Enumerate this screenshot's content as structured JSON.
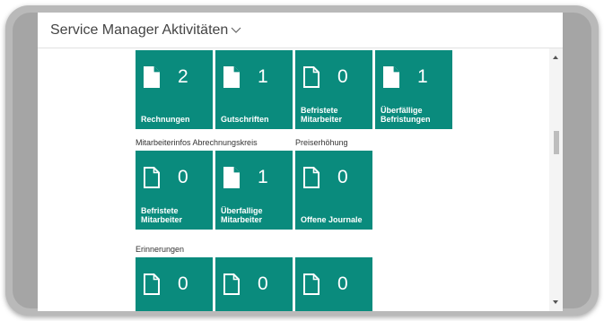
{
  "header": {
    "title": "Service Manager Aktivitäten"
  },
  "sections": {
    "abrechnung": "Mitarbeiterinfos Abrechnungskreis",
    "preis": "Preiserhöhung",
    "erinnerungen": "Erinnerungen"
  },
  "tiles": [
    {
      "count": "2",
      "label": "Rechnungen",
      "icon": "document-filled-icon"
    },
    {
      "count": "1",
      "label": "Gutschriften",
      "icon": "document-filled-icon"
    },
    {
      "count": "0",
      "label": "Befristete Mitarbeiter",
      "icon": "document-outline-icon"
    },
    {
      "count": "1",
      "label": "Überfällige Befristungen",
      "icon": "document-filled-icon"
    },
    {
      "count": "0",
      "label": "Befristete Mitarbeiter",
      "icon": "document-outline-icon"
    },
    {
      "count": "1",
      "label": "Überfallige Mitarbeiter",
      "icon": "document-filled-icon"
    },
    {
      "count": "0",
      "label": "Offene Journale",
      "icon": "document-outline-icon"
    },
    {
      "count": "0",
      "label": "",
      "icon": "document-outline-icon"
    },
    {
      "count": "0",
      "label": "",
      "icon": "document-outline-icon"
    },
    {
      "count": "0",
      "label": "",
      "icon": "document-outline-icon"
    }
  ],
  "colors": {
    "tile": "#0a8b7d",
    "tile_text": "#ffffff",
    "frame": "#a5a5a5"
  }
}
